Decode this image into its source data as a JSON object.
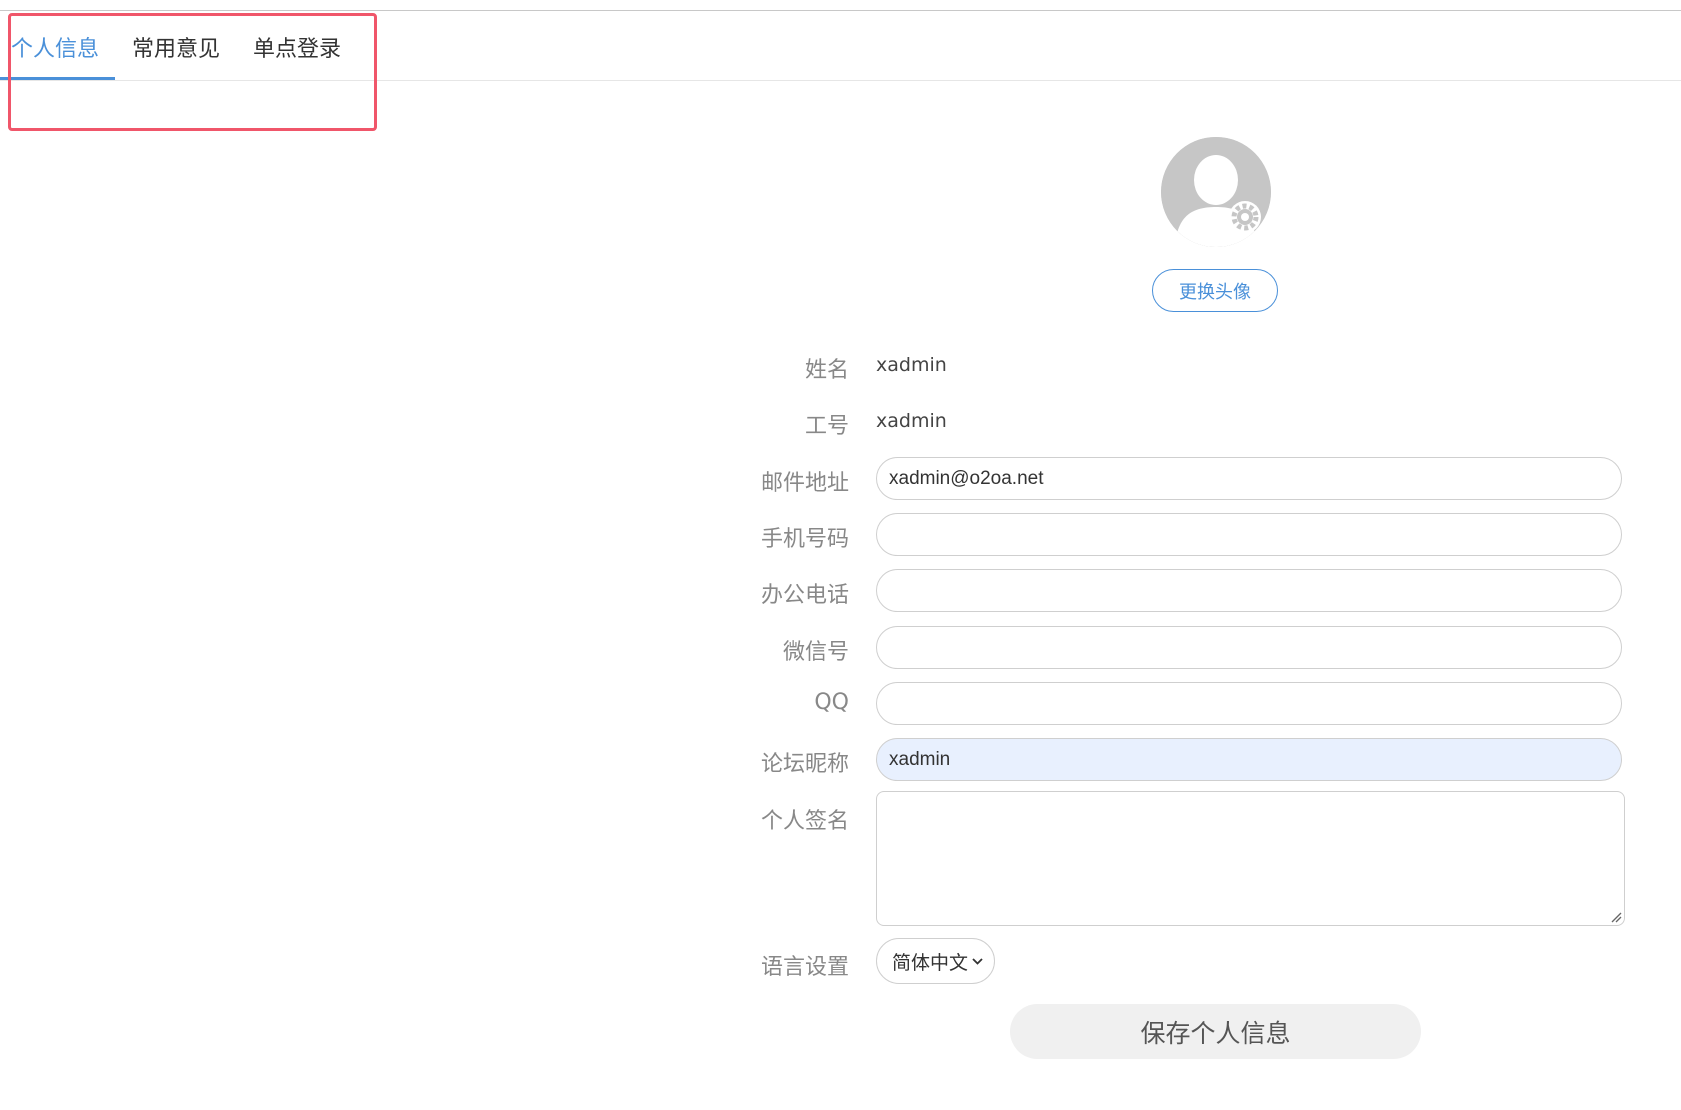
{
  "tabs": [
    {
      "label": "个人信息",
      "active": true
    },
    {
      "label": "常用意见",
      "active": false
    },
    {
      "label": "单点登录",
      "active": false
    }
  ],
  "avatar": {
    "icon": "user-avatar-icon",
    "change_label": "更换头像"
  },
  "form": {
    "name": {
      "label": "姓名",
      "value": "xadmin"
    },
    "employee_id": {
      "label": "工号",
      "value": "xadmin"
    },
    "email": {
      "label": "邮件地址",
      "value": "xadmin@o2oa.net"
    },
    "mobile": {
      "label": "手机号码",
      "value": ""
    },
    "office_phone": {
      "label": "办公电话",
      "value": ""
    },
    "wechat": {
      "label": "微信号",
      "value": ""
    },
    "qq": {
      "label": "QQ",
      "value": ""
    },
    "forum_nickname": {
      "label": "论坛昵称",
      "value": "xadmin"
    },
    "signature": {
      "label": "个人签名",
      "value": ""
    },
    "language": {
      "label": "语言设置",
      "value": "简体中文"
    }
  },
  "save_label": "保存个人信息",
  "colors": {
    "accent": "#4a90d9",
    "highlight_box": "#f0566a",
    "autofill_bg": "#e8f0fe"
  }
}
